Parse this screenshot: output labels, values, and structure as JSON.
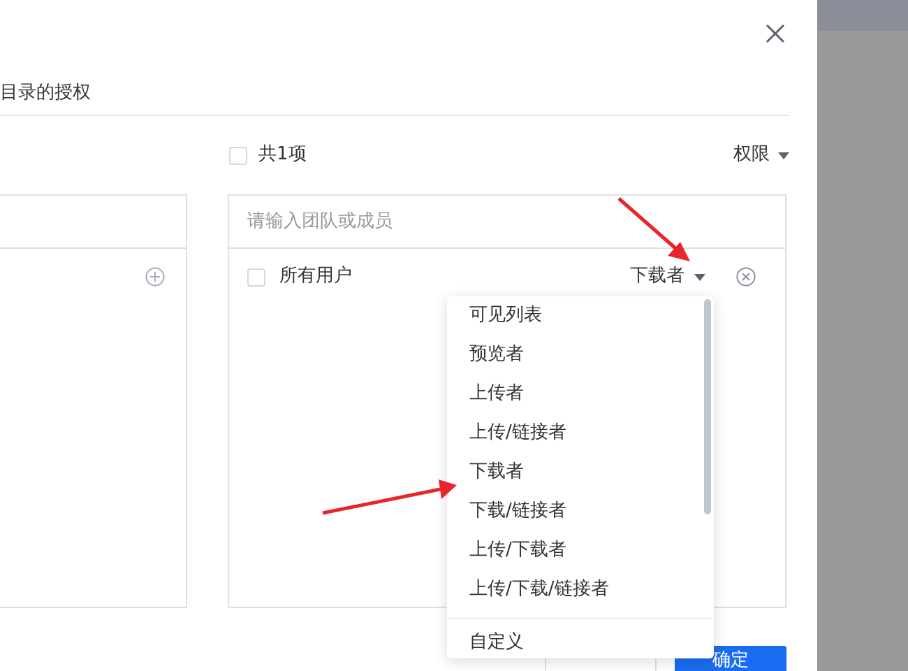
{
  "dialog": {
    "tab": "目录的授权",
    "select_all": {
      "checked": false,
      "label": "共1项"
    },
    "permission_header": "权限",
    "search": {
      "placeholder": "请输入团队或成员"
    },
    "members": [
      {
        "name": "所有用户",
        "checked": false,
        "role": "下载者"
      }
    ],
    "dropdown": {
      "items": [
        {
          "label": "可见列表",
          "kind": "option"
        },
        {
          "label": "预览者",
          "kind": "option"
        },
        {
          "label": "上传者",
          "kind": "option"
        },
        {
          "label": "上传/链接者",
          "kind": "option"
        },
        {
          "label": "下载者",
          "kind": "option"
        },
        {
          "label": "下载/链接者",
          "kind": "option"
        },
        {
          "label": "上传/下载者",
          "kind": "option"
        },
        {
          "label": "上传/下载/链接者",
          "kind": "option"
        },
        {
          "label": "自定义",
          "kind": "custom"
        }
      ]
    },
    "buttons": [
      {
        "kind": "secondary"
      },
      {
        "label": "确定",
        "kind": "primary"
      }
    ]
  }
}
